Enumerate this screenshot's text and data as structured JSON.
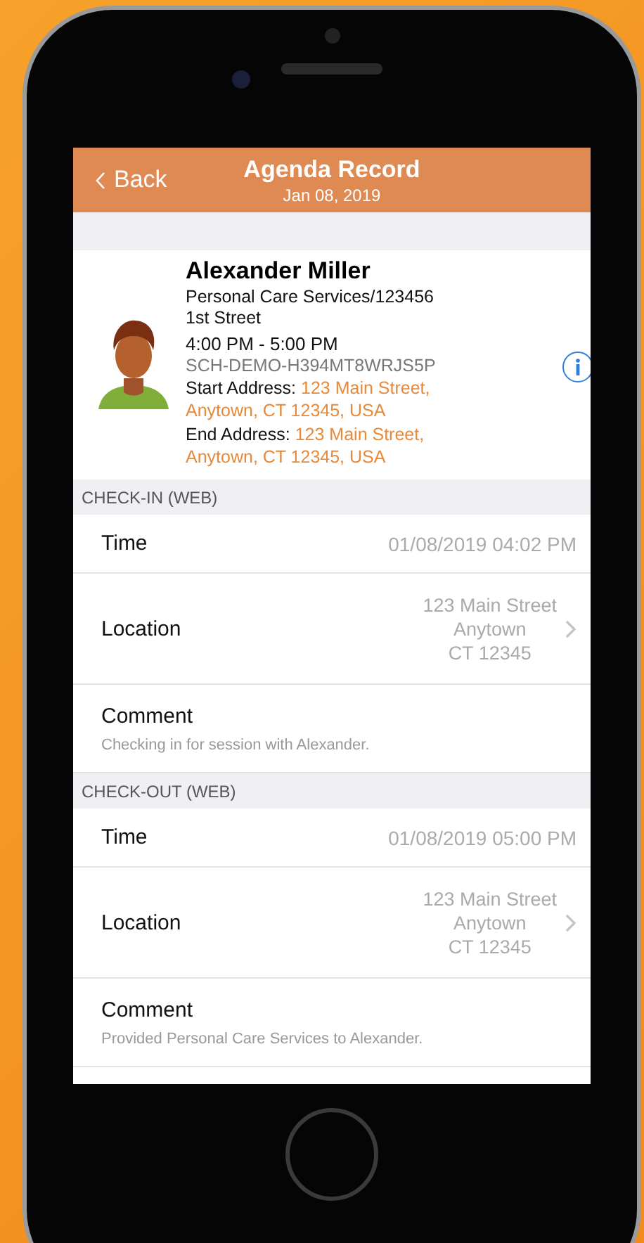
{
  "nav_bar": {
    "back": "Back",
    "title": "Agenda Record",
    "subtitle": "Jan 08, 2019"
  },
  "profile": {
    "name": "Alexander Miller",
    "service": "Personal Care Services/123456",
    "street": "1st Street",
    "time": "4:00 PM - 5:00 PM",
    "code": "SCH-DEMO-H394MT8WRJS5P",
    "addresses": [
      {
        "label": "Start Address:",
        "value": "123 Main Street, Anytown, CT 12345, USA"
      },
      {
        "label": "End Address:",
        "value": "123 Main Street, Anytown, CT 12345, USA"
      }
    ]
  },
  "sections": [
    {
      "title": "CHECK-IN (WEB)",
      "rows": [
        {
          "kind": "time",
          "label": "Time",
          "value": "01/08/2019 04:02 PM"
        },
        {
          "kind": "location",
          "label": "Location",
          "lines": [
            "123 Main Street",
            "Anytown",
            "CT 12345"
          ]
        },
        {
          "kind": "comment",
          "label": "Comment",
          "value": "Checking in for session with Alexander."
        }
      ]
    },
    {
      "title": "CHECK-OUT (WEB)",
      "rows": [
        {
          "kind": "time",
          "label": "Time",
          "value": "01/08/2019 05:00 PM"
        },
        {
          "kind": "location",
          "label": "Location",
          "lines": [
            "123 Main Street",
            "Anytown",
            "CT 12345"
          ]
        },
        {
          "kind": "comment",
          "label": "Comment",
          "value": "Provided Personal Care Services to Alexander."
        }
      ]
    }
  ]
}
